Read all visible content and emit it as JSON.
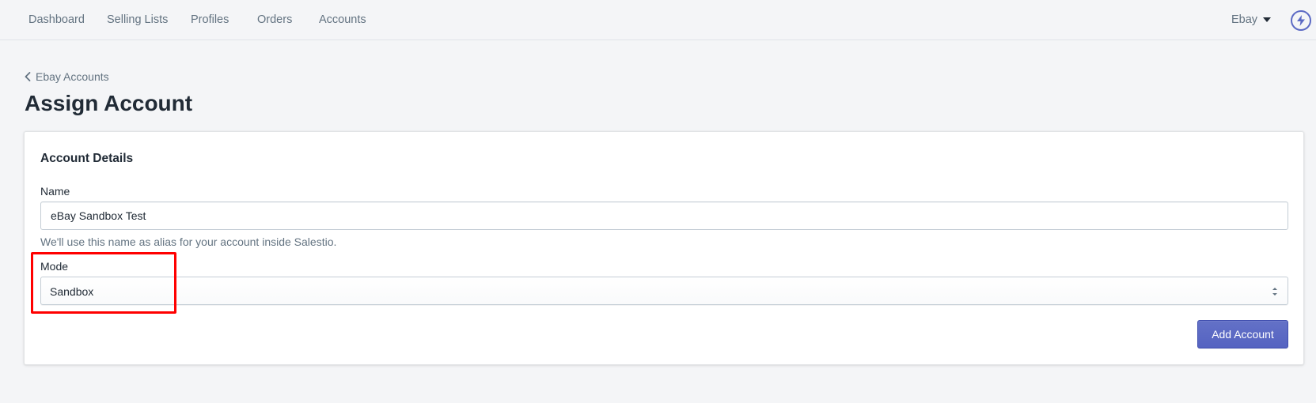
{
  "nav": {
    "items": [
      {
        "label": "Dashboard"
      },
      {
        "label": "Selling Lists"
      },
      {
        "label": "Profiles"
      },
      {
        "label": "Orders"
      },
      {
        "label": "Accounts"
      }
    ],
    "store_switcher": "Ebay",
    "store_switcher_icon": "chevron-down-icon",
    "action_icon": "lightning-bolt-icon"
  },
  "breadcrumb": {
    "label": "Ebay Accounts",
    "icon": "chevron-left-icon"
  },
  "page_title": "Assign Account",
  "card": {
    "title": "Account Details",
    "name_field": {
      "label": "Name",
      "value": "eBay Sandbox Test",
      "help": "We'll use this name as alias for your account inside Salestio."
    },
    "mode_field": {
      "label": "Mode",
      "selected": "Sandbox",
      "icon": "select-arrows-icon"
    },
    "submit_label": "Add Account"
  },
  "colors": {
    "accent": "#5c6ac4",
    "highlight": "#ff0000",
    "background": "#f4f5f7"
  }
}
